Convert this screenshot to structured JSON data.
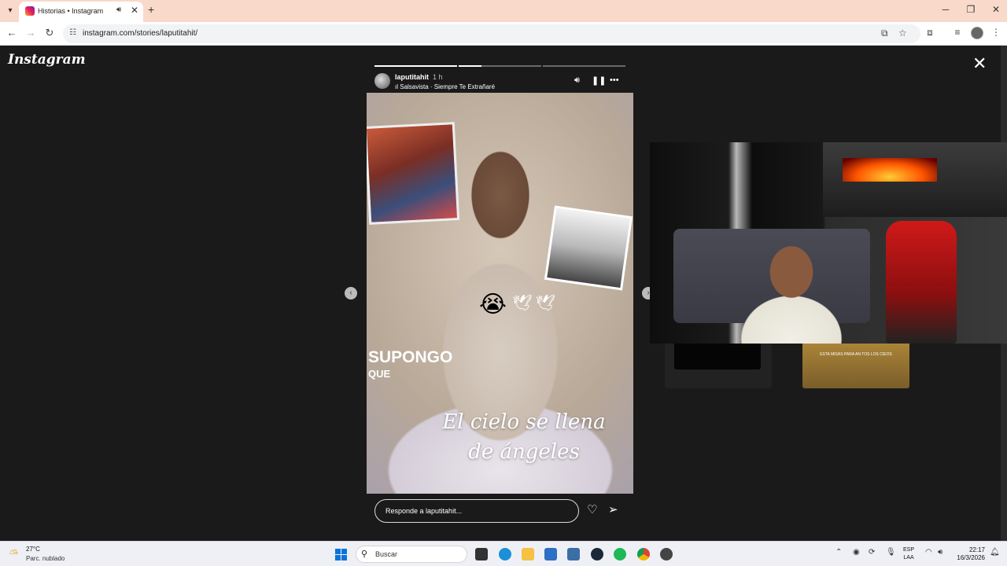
{
  "browser": {
    "tab": {
      "title": "Historias • Instagram"
    },
    "url": "instagram.com/stories/laputitahit/"
  },
  "page": {
    "logo": "Instagram",
    "story": {
      "username": "laputitahit",
      "time": "1 h",
      "music": "Salsavista · Siempre Te Extrañaré",
      "progress": [
        1.0,
        0.28,
        0.0
      ],
      "overlay_text_big": "SUPONGO",
      "overlay_text_small": "QUE",
      "script_text": "El cielo se llena de ángeles",
      "reply_placeholder": "Responde a laputitahit..."
    },
    "preview_text": "ESTA MISAS PARA AN TOS LOS CIEOS"
  },
  "taskbar": {
    "weather_temp": "27°C",
    "weather_desc": "Parc. nublado",
    "search_placeholder": "Buscar",
    "lang_top": "ESP",
    "lang_bottom": "LAA",
    "time": "22:17",
    "date": "16/3/2026"
  },
  "colors": {
    "tabstrip": "#f9d9c9",
    "page_bg": "#1a1a1a",
    "start_blue": "#0a74da"
  }
}
